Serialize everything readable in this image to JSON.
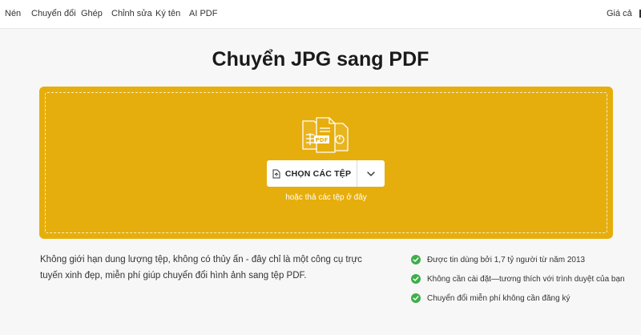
{
  "nav": {
    "items": [
      "Nén",
      "Chuyển đổi",
      "Ghép",
      "Chỉnh sửa",
      "Ký tên",
      "AI PDF"
    ],
    "pricing": "Giá cả"
  },
  "main": {
    "title": "Chuyển JPG sang PDF"
  },
  "upload": {
    "choose_label": "CHỌN CÁC TỆP",
    "drop_hint": "hoặc thả các tệp ở đây",
    "illustration_badge": "PDF",
    "background_color": "#e6ae0c"
  },
  "description": "Không giới hạn dung lượng tệp, không có thủy ấn - đây chỉ là một công cụ trực tuyến xinh đẹp, miễn phí giúp chuyển đổi hình ảnh sang tệp PDF.",
  "features": [
    "Được tin dùng bởi 1,7 tỷ người từ năm 2013",
    "Không cần cài đặt—tương thích với trình duyệt của bạn",
    "Chuyển đổi miễn phí không cần đăng ký"
  ],
  "icons": {
    "check": "check-circle-icon",
    "file": "file-icon",
    "dropdown": "chevron-down-icon",
    "illustration": "files-illustration-icon"
  },
  "colors": {
    "accent": "#e6ae0c",
    "check": "#3fae4a"
  }
}
